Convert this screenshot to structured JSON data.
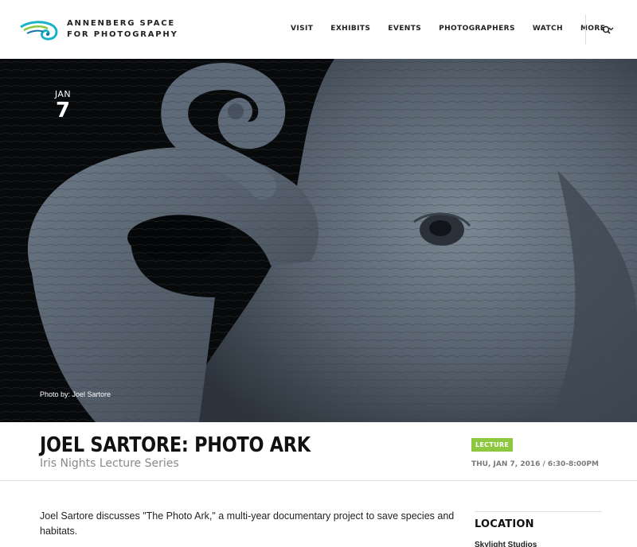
{
  "logo": {
    "line1": "ANNENBERG SPACE",
    "line2": "FOR PHOTOGRAPHY",
    "colors": [
      "#1bb1c6",
      "#8dc63f",
      "#1673a7"
    ]
  },
  "nav": {
    "items": [
      {
        "label": "VISIT"
      },
      {
        "label": "EXHIBITS"
      },
      {
        "label": "EVENTS"
      },
      {
        "label": "PHOTOGRAPHERS"
      },
      {
        "label": "WATCH"
      },
      {
        "label": "MORE"
      }
    ],
    "search_icon": "search-icon"
  },
  "hero": {
    "month": "JAN",
    "day": "7",
    "credit": "Photo by: Joel Sartore"
  },
  "event": {
    "title": "JOEL SARTORE: PHOTO ARK",
    "subtitle": "Iris Nights Lecture Series",
    "badge": "LECTURE",
    "badge_color": "#8dc63f",
    "datetime": "THU, JAN 7, 2016 / 6:30-8:00PM"
  },
  "content": {
    "description": "Joel Sartore discusses \"The Photo Ark,\" a multi-year documentary project to save species and habitats."
  },
  "sidebar": {
    "location_heading": "LOCATION",
    "location_name": "Skylight Studios"
  }
}
